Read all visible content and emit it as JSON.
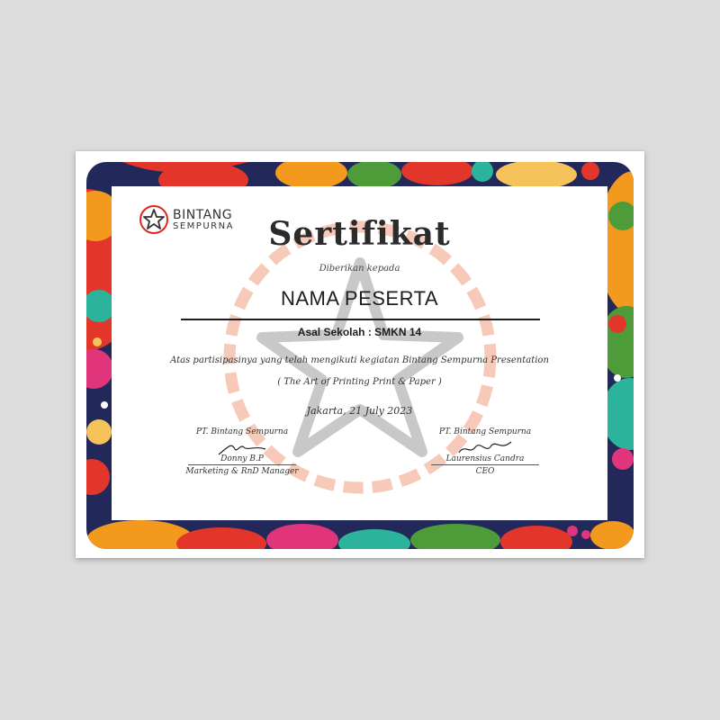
{
  "logo": {
    "line1": "BINTANG",
    "line2": "SEMPURNA",
    "brand_color": "#e2241f"
  },
  "certificate": {
    "title": "Sertifikat",
    "given_to": "Diberikan kepada",
    "recipient_name": "NAMA PESERTA",
    "school_label": "Asal Sekolah :",
    "school_value": "SMKN 14",
    "participation_text": "Atas partisipasinya yang telah mengikuti kegiatan Bintang Sempurna Presentation",
    "event_subtitle": "( The Art of Printing Print & Paper )",
    "date": "Jakarta, 21 July 2023"
  },
  "signatories": [
    {
      "company": "PT. Bintang Sempurna",
      "name": "Donny B.P",
      "role": "Marketing & RnD Manager"
    },
    {
      "company": "PT. Bintang Sempurna",
      "name": "Laurensius Candra",
      "role": "CEO"
    }
  ],
  "colors": {
    "watermark_ring": "#f6c9b8",
    "watermark_star": "#c8c8c8",
    "border_navy": "#22285a",
    "border_red": "#e2362b",
    "border_orange": "#f39a1e",
    "border_teal": "#2bb39b",
    "border_pink": "#e0357a",
    "border_green": "#4e9b3a"
  },
  "icons": [
    "star-logo-icon",
    "star-watermark-icon"
  ]
}
